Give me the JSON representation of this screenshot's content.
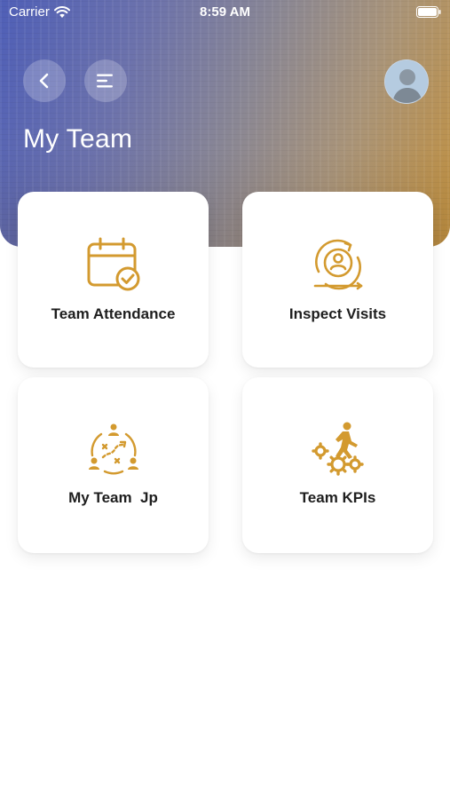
{
  "status_bar": {
    "carrier": "Carrier",
    "time": "8:59 AM"
  },
  "header": {
    "title": "My Team",
    "back_icon": "chevron-left-icon",
    "menu_icon": "menu-icon",
    "avatar_icon": "user-avatar"
  },
  "tiles": [
    {
      "label": "Team Attendance",
      "icon": "calendar-check-icon"
    },
    {
      "label": "Inspect Visits",
      "icon": "visit-cycle-icon"
    },
    {
      "label": "My Team  Jp",
      "icon": "team-plan-icon"
    },
    {
      "label": "Team KPIs",
      "icon": "kpi-gears-icon"
    }
  ],
  "colors": {
    "accent": "#d39a2f",
    "hero_start": "#4f5fb7",
    "hero_end": "#c2913f"
  }
}
